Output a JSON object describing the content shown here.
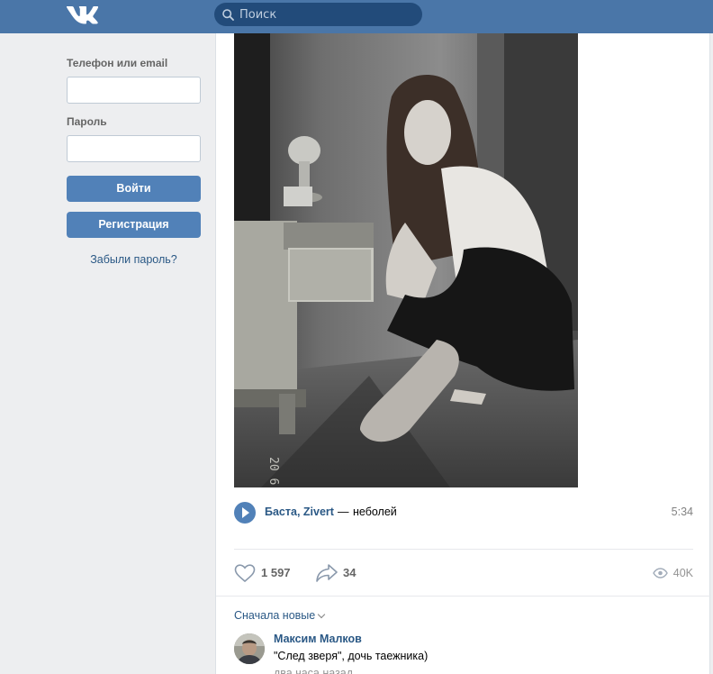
{
  "header": {
    "logo_icon": "vk-logo-icon",
    "search_placeholder": "Поиск",
    "search_icon": "search-icon",
    "brand_color": "#4a76a8"
  },
  "login": {
    "phone_label": "Телефон или email",
    "phone_value": "",
    "password_label": "Пароль",
    "password_value": "",
    "login_button": "Войти",
    "register_button": "Регистрация",
    "forgot_link": "Забыли пароль?"
  },
  "post": {
    "photo_icon": "post-photo",
    "audio": {
      "artist": "Баста, Zivert",
      "dash": "—",
      "title": "неболей",
      "duration": "5:34"
    },
    "likes": "1 597",
    "shares": "34",
    "views": "40K"
  },
  "comments": {
    "sort_label": "Сначала новые",
    "items": [
      {
        "author": "Максим Малков",
        "text": "\"След зверя\", дочь таежника)",
        "time": "два часа назад"
      }
    ]
  }
}
